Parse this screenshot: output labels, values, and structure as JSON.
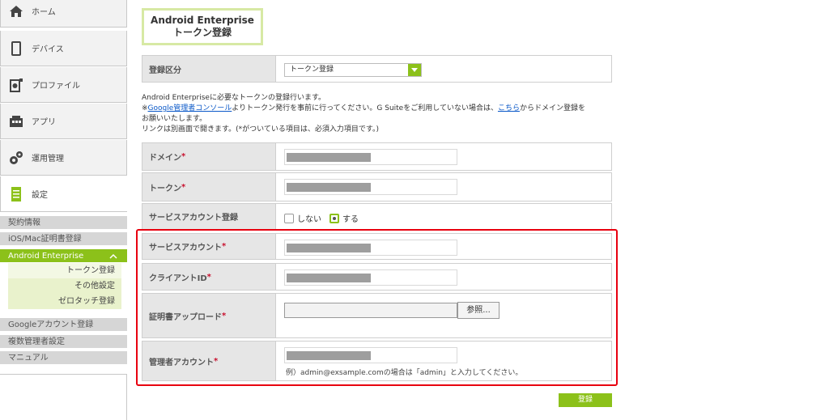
{
  "sidebar": {
    "nav": [
      {
        "label": "ホーム",
        "icon": "home-icon"
      },
      {
        "label": "デバイス",
        "icon": "device-icon"
      },
      {
        "label": "プロファイル",
        "icon": "profile-icon"
      },
      {
        "label": "アプリ",
        "icon": "app-icon"
      },
      {
        "label": "運用管理",
        "icon": "operation-icon"
      },
      {
        "label": "設定",
        "icon": "settings-icon"
      }
    ],
    "sub_items": [
      {
        "label": "契約情報"
      },
      {
        "label": "iOS/Mac証明書登録"
      },
      {
        "label": "Android Enterprise"
      }
    ],
    "sub_sub_items": [
      {
        "label": "トークン登録"
      },
      {
        "label": "その他設定"
      },
      {
        "label": "ゼロタッチ登録"
      }
    ],
    "more_items": [
      {
        "label": "Googleアカウント登録"
      },
      {
        "label": "複数管理者設定"
      },
      {
        "label": "マニュアル"
      }
    ]
  },
  "page": {
    "title_line1": "Android Enterprise",
    "title_line2": "トークン登録"
  },
  "form": {
    "category_label": "登録区分",
    "category_value": "トークン登録",
    "desc_line1": "Android Enterpriseに必要なトークンの登録行います。",
    "desc_prefix": "※",
    "desc_link1": "Google管理者コンソール",
    "desc_mid": "よりトークン発行を事前に行ってください。G Suiteをご利用していない場合は、",
    "desc_link2": "こちら",
    "desc_suffix": "からドメイン登録を",
    "desc_line3": "お願いいたします。",
    "desc_line4": "リンクは別画面で開きます。(*がついている項目は、必須入力項目です。)",
    "required_mark": "*",
    "domain_label": "ドメイン",
    "token_label": "トークン",
    "svc_reg_label": "サービスアカウント登録",
    "radio_no": "しない",
    "radio_yes": "する",
    "svc_account_label": "サービスアカウント",
    "client_id_label": "クライアントID",
    "cert_upload_label": "証明書アップロード",
    "browse_label": "参照...",
    "admin_account_label": "管理者アカウント",
    "admin_hint": "例）admin@exsample.comの場合は「admin」と入力してください。",
    "submit_label": "登録"
  },
  "colors": {
    "accent": "#8cc11a",
    "highlight": "#e8000f",
    "link": "#0a58c8"
  }
}
